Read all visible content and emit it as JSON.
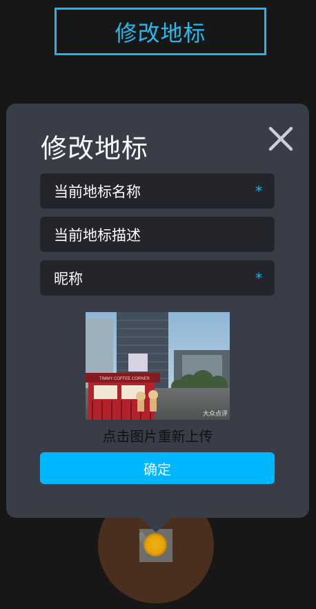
{
  "header": {
    "title": "修改地标"
  },
  "dialog": {
    "title": "修改地标",
    "fields": [
      {
        "label": "当前地标名称",
        "required_mark": "*"
      },
      {
        "label": "当前地标描述",
        "required_mark": ""
      },
      {
        "label": "昵称",
        "required_mark": "*"
      }
    ],
    "photo": {
      "storefront_sign": "TIMMY COFFEE CORNER",
      "watermark": "大众点评"
    },
    "reupload_label": "点击图片重新上传",
    "confirm_label": "确定"
  },
  "colors": {
    "accent": "#19b8ee",
    "button": "#00b7ff",
    "dialog_bg": "#393d47",
    "field_bg": "#23252b",
    "page_bg": "#171717",
    "map_circle": "#4a2f1f"
  },
  "icons": {
    "close": "close-icon",
    "location": "location-marker-icon"
  }
}
